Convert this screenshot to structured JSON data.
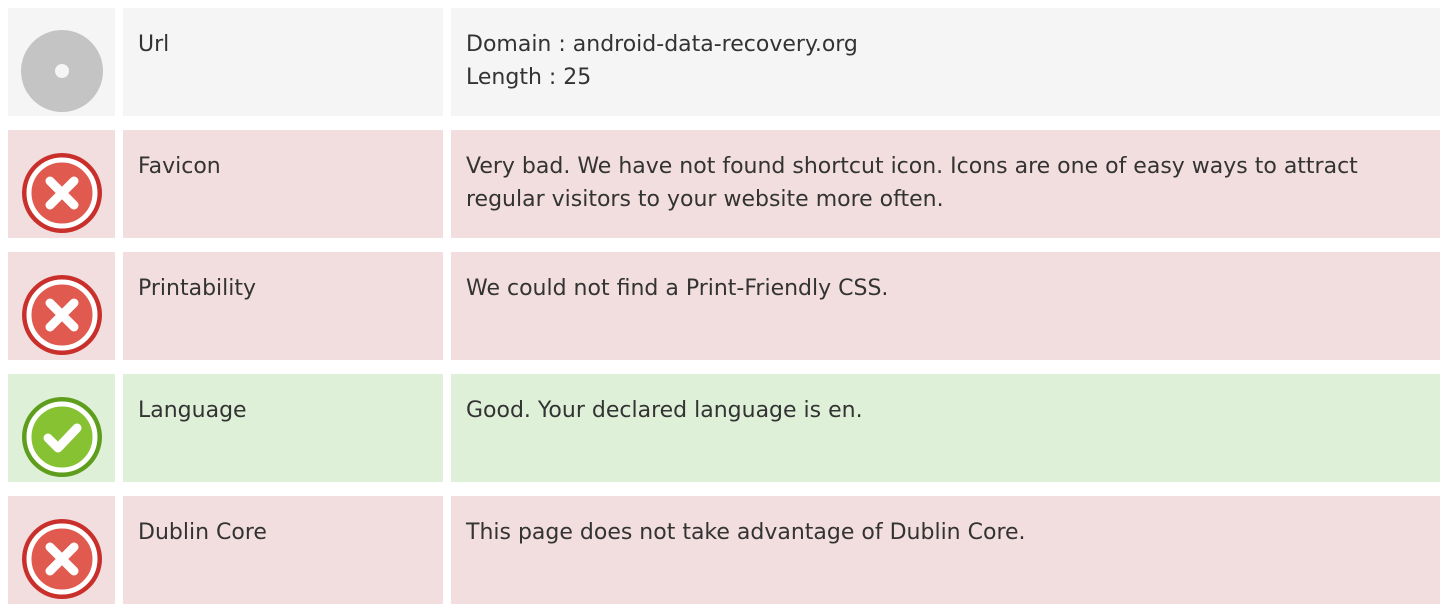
{
  "rows": [
    {
      "status": "neutral",
      "icon": "neutral-dot-icon",
      "name": "Url",
      "lines": [
        "Domain : android-data-recovery.org",
        "Length : 25"
      ]
    },
    {
      "status": "bad",
      "icon": "error-cross-icon",
      "name": "Favicon",
      "lines": [
        "Very bad. We have not found shortcut icon. Icons are one of easy ways to attract regular visitors to your website more often."
      ]
    },
    {
      "status": "bad",
      "icon": "error-cross-icon",
      "name": "Printability",
      "lines": [
        "We could not find a Print-Friendly CSS."
      ]
    },
    {
      "status": "good",
      "icon": "success-check-icon",
      "name": "Language",
      "lines": [
        "Good. Your declared language is en."
      ]
    },
    {
      "status": "bad",
      "icon": "error-cross-icon",
      "name": "Dublin Core",
      "lines": [
        "This page does not take advantage of Dublin Core."
      ]
    }
  ],
  "colors": {
    "neutral_bg": "#f5f5f5",
    "bad_bg": "#f2dede",
    "good_bg": "#dff0d8",
    "error_red": "#d9403a",
    "success_green": "#7dbb2a",
    "neutral_gray": "#c4c4c4"
  }
}
